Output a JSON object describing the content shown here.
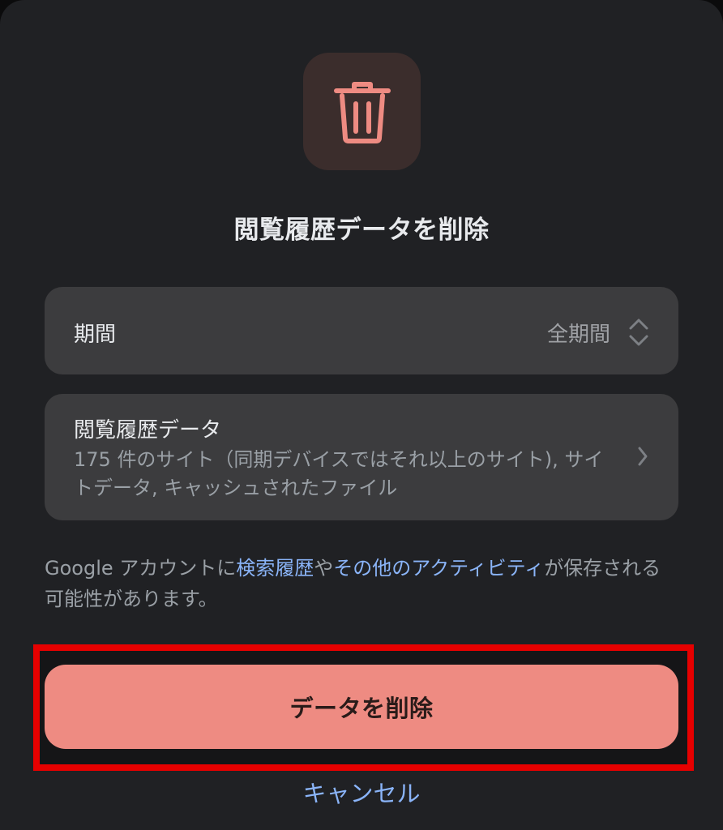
{
  "dialog": {
    "icon": "trash-icon",
    "title": "閲覧履歴データを削除"
  },
  "period": {
    "label": "期間",
    "value": "全期間",
    "icon": "up-down-chevron-icon"
  },
  "browsing_data": {
    "label": "閲覧履歴データ",
    "description": "175 件のサイト（同期デバイスではそれ以上のサイト), サイトデータ, キャッシュされたファイル",
    "icon": "chevron-right-icon"
  },
  "note": {
    "part1": "Google アカウントに",
    "link1": "検索履歴",
    "part2": "や",
    "link2": "その他のアクティビティ",
    "part3": "が保存される可能性があります。"
  },
  "actions": {
    "delete_label": "データを削除",
    "cancel_label": "キャンセル"
  },
  "colors": {
    "background": "#202124",
    "card": "#3c3c3e",
    "accent": "#ee8b82",
    "link": "#8ab4f8",
    "highlight": "#e60000"
  }
}
